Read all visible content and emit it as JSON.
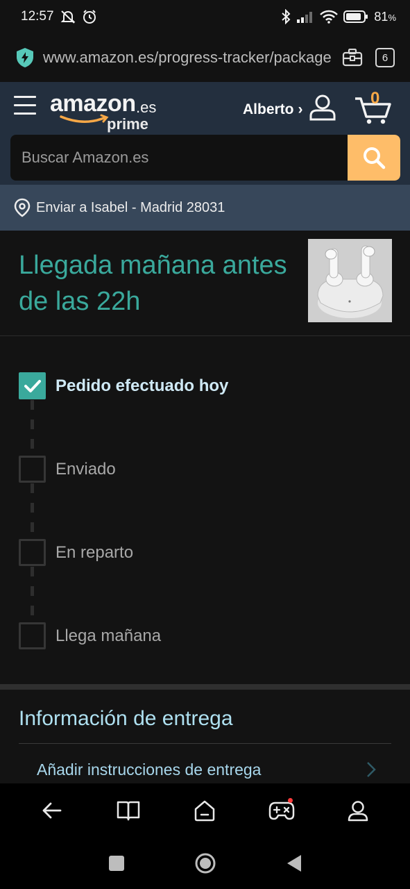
{
  "status_bar": {
    "time": "12:57",
    "battery": "81",
    "battery_unit": "%"
  },
  "browser": {
    "url": "www.amazon.es/progress-tracker/package",
    "tabs_count": "6"
  },
  "header": {
    "logo_word": "amazon",
    "logo_tld": ".es",
    "logo_sub": "prime",
    "account_name": "Alberto",
    "account_chevron": "›",
    "cart_count": "0",
    "search_placeholder": "Buscar Amazon.es"
  },
  "deliver_to": {
    "label": "Enviar a Isabel - Madrid 28031"
  },
  "arrival": {
    "title": "Llegada mañana antes de las 22h",
    "product_image": "wireless-earbuds"
  },
  "tracker": {
    "steps": [
      {
        "label": "Pedido efectuado hoy",
        "done": true
      },
      {
        "label": "Enviado",
        "done": false
      },
      {
        "label": "En reparto",
        "done": false
      },
      {
        "label": "Llega mañana",
        "done": false
      }
    ]
  },
  "delivery_info": {
    "title": "Información de entrega",
    "add_instructions": "Añadir instrucciones de entrega"
  },
  "colors": {
    "accent_teal": "#3aa99c",
    "search_orange": "#febd69",
    "header_navy": "#232f3e",
    "deliver_bar": "#37475a",
    "cart_orange": "#f7a847"
  }
}
